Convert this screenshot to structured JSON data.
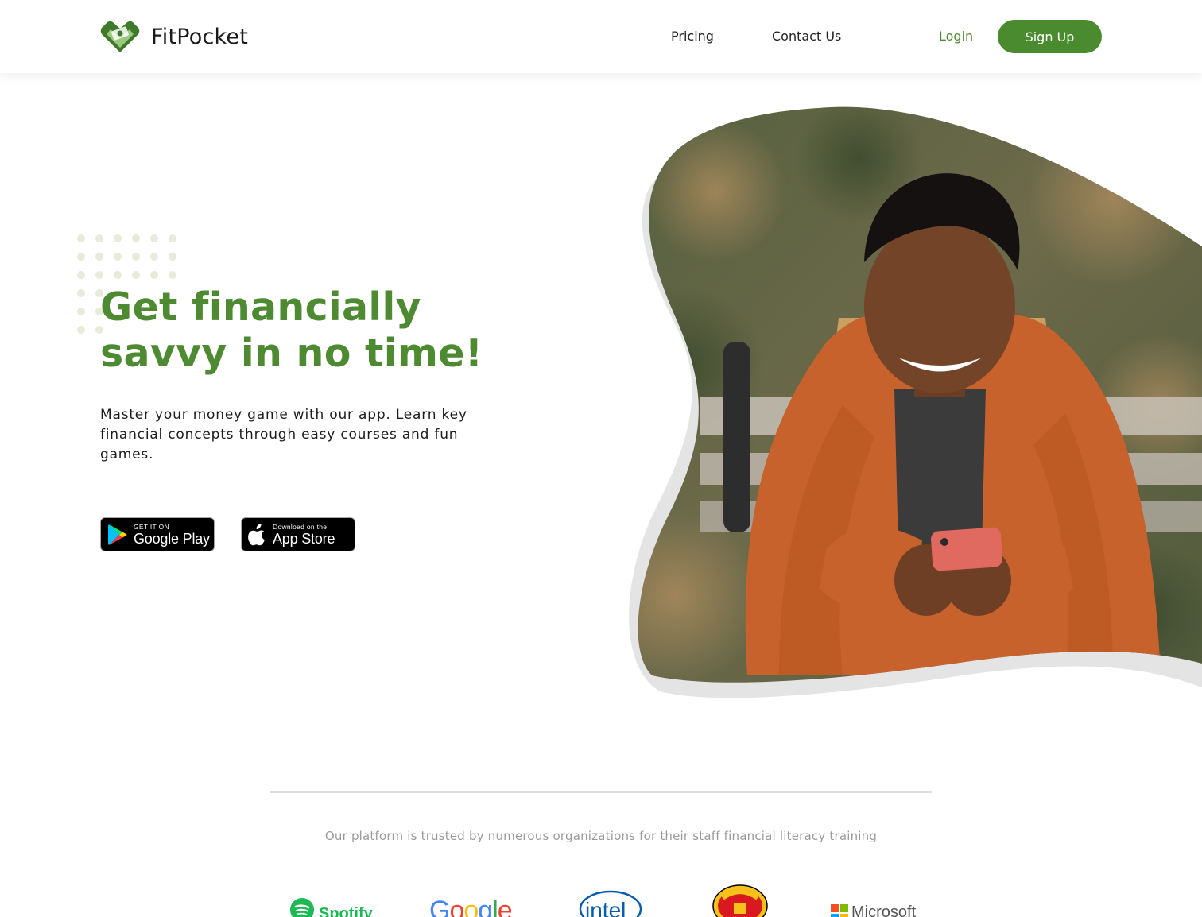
{
  "header": {
    "brand": "FitPocket",
    "nav": {
      "pricing": "Pricing",
      "contact": "Contact Us",
      "login": "Login",
      "signup": "Sign Up"
    }
  },
  "hero": {
    "title_line1": "Get financially",
    "title_line2": "savvy in no time!",
    "subtitle": "Master your money game with our app. Learn key financial concepts through easy courses and fun games.",
    "google_play": {
      "small": "GET IT ON",
      "big": "Google Play",
      "icon": "google-play-icon"
    },
    "app_store": {
      "small": "Download on the",
      "big": "App Store",
      "icon": "apple-icon"
    },
    "image_alt": "Smiling young man in orange fleece jacket looking at his phone while sitting on a bench"
  },
  "trust": {
    "text": "Our platform is trusted by numerous organizations for their staff financial literacy training",
    "logos": {
      "spotify": "Spotify",
      "google": "Google",
      "intel": "intel",
      "manutd": "Manchester United",
      "microsoft": "Microsoft"
    }
  },
  "colors": {
    "brand_green": "#4b8b2f",
    "title_green": "#4d8a31",
    "muted_text": "#9a9a9a"
  }
}
